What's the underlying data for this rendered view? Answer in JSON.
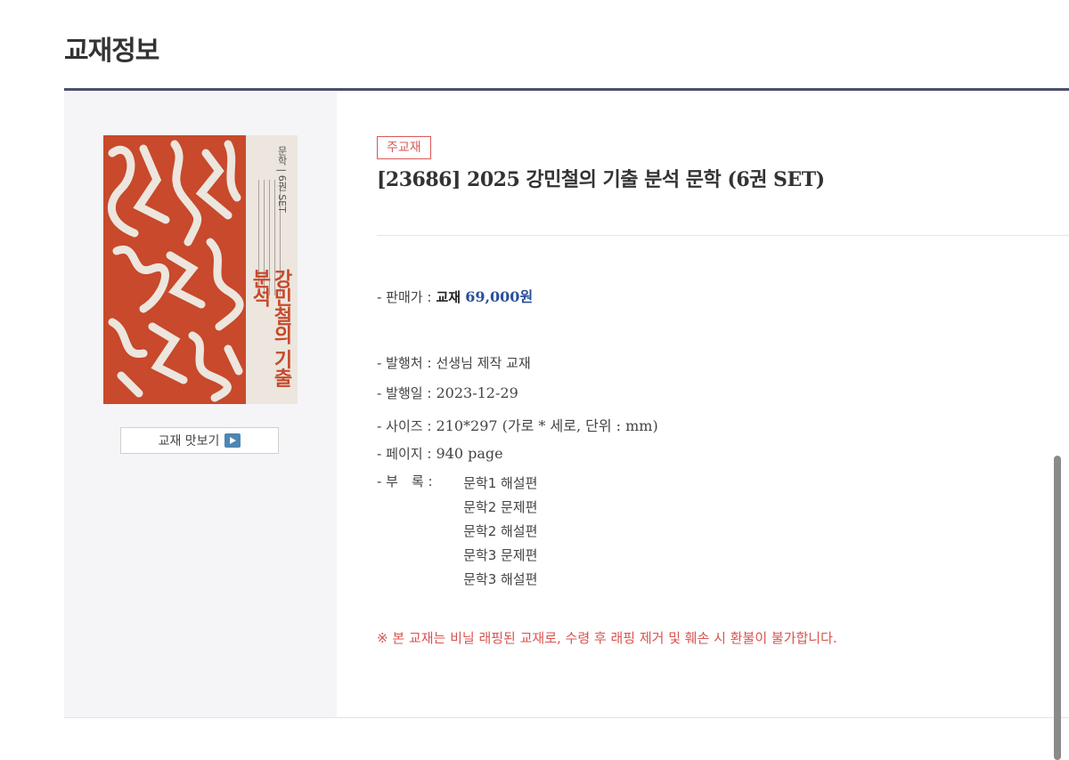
{
  "section": {
    "title": "교재정보"
  },
  "preview": {
    "label": "교재 맛보기"
  },
  "cover": {
    "title": "강민철의 기출분석",
    "subtitle": "문학 | 6권 SET"
  },
  "product": {
    "badge": "주교재",
    "title": "[23686] 2025 강민철의 기출 분석 문학 (6권 SET)",
    "price_label": "- 판매가 :",
    "price_type": "교재",
    "price_value": "69,000원",
    "publisher_label": "- 발행처 :",
    "publisher": "선생님 제작 교재",
    "date_label": "- 발행일 :",
    "date": "2023-12-29",
    "size_label": "- 사이즈 :",
    "size": "210*297 (가로 * 세로, 단위 : mm)",
    "pages_label": "- 페이지 :",
    "pages": "940 page",
    "appendix_label": "- 부　록 :",
    "appendix": [
      "문학1 해설편",
      "문학2 문제편",
      "문학2 해설편",
      "문학3 문제편",
      "문학3 해설편"
    ],
    "notice": "※ 본 교재는 비닐 래핑된 교재로, 수령 후 래핑 제거 및 훼손 시 환불이 불가합니다."
  },
  "colors": {
    "accent_red": "#d9534f",
    "price_blue": "#2a4f9a",
    "rule_navy": "#4a4f6a",
    "cover_orange": "#c8492b"
  }
}
